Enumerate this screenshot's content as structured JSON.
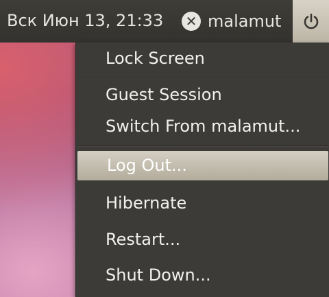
{
  "panel": {
    "datetime": "Вск Июн 13, 21:33",
    "user_name": "malamut",
    "user_icon": "x-circle-icon",
    "power_icon": "power-icon"
  },
  "menu": {
    "items": [
      {
        "label": "Lock Screen"
      },
      {
        "label": "Guest Session"
      },
      {
        "label": "Switch From malamut..."
      },
      {
        "label": "Log Out..."
      },
      {
        "label": "Hibernate"
      },
      {
        "label": "Restart..."
      },
      {
        "label": "Shut Down..."
      }
    ],
    "highlighted_index": 3
  },
  "colors": {
    "panel_bg": "#3c3b37",
    "menu_bg": "#3c3b37",
    "highlight": "#c6c0b2",
    "text": "#f2f1ee"
  }
}
